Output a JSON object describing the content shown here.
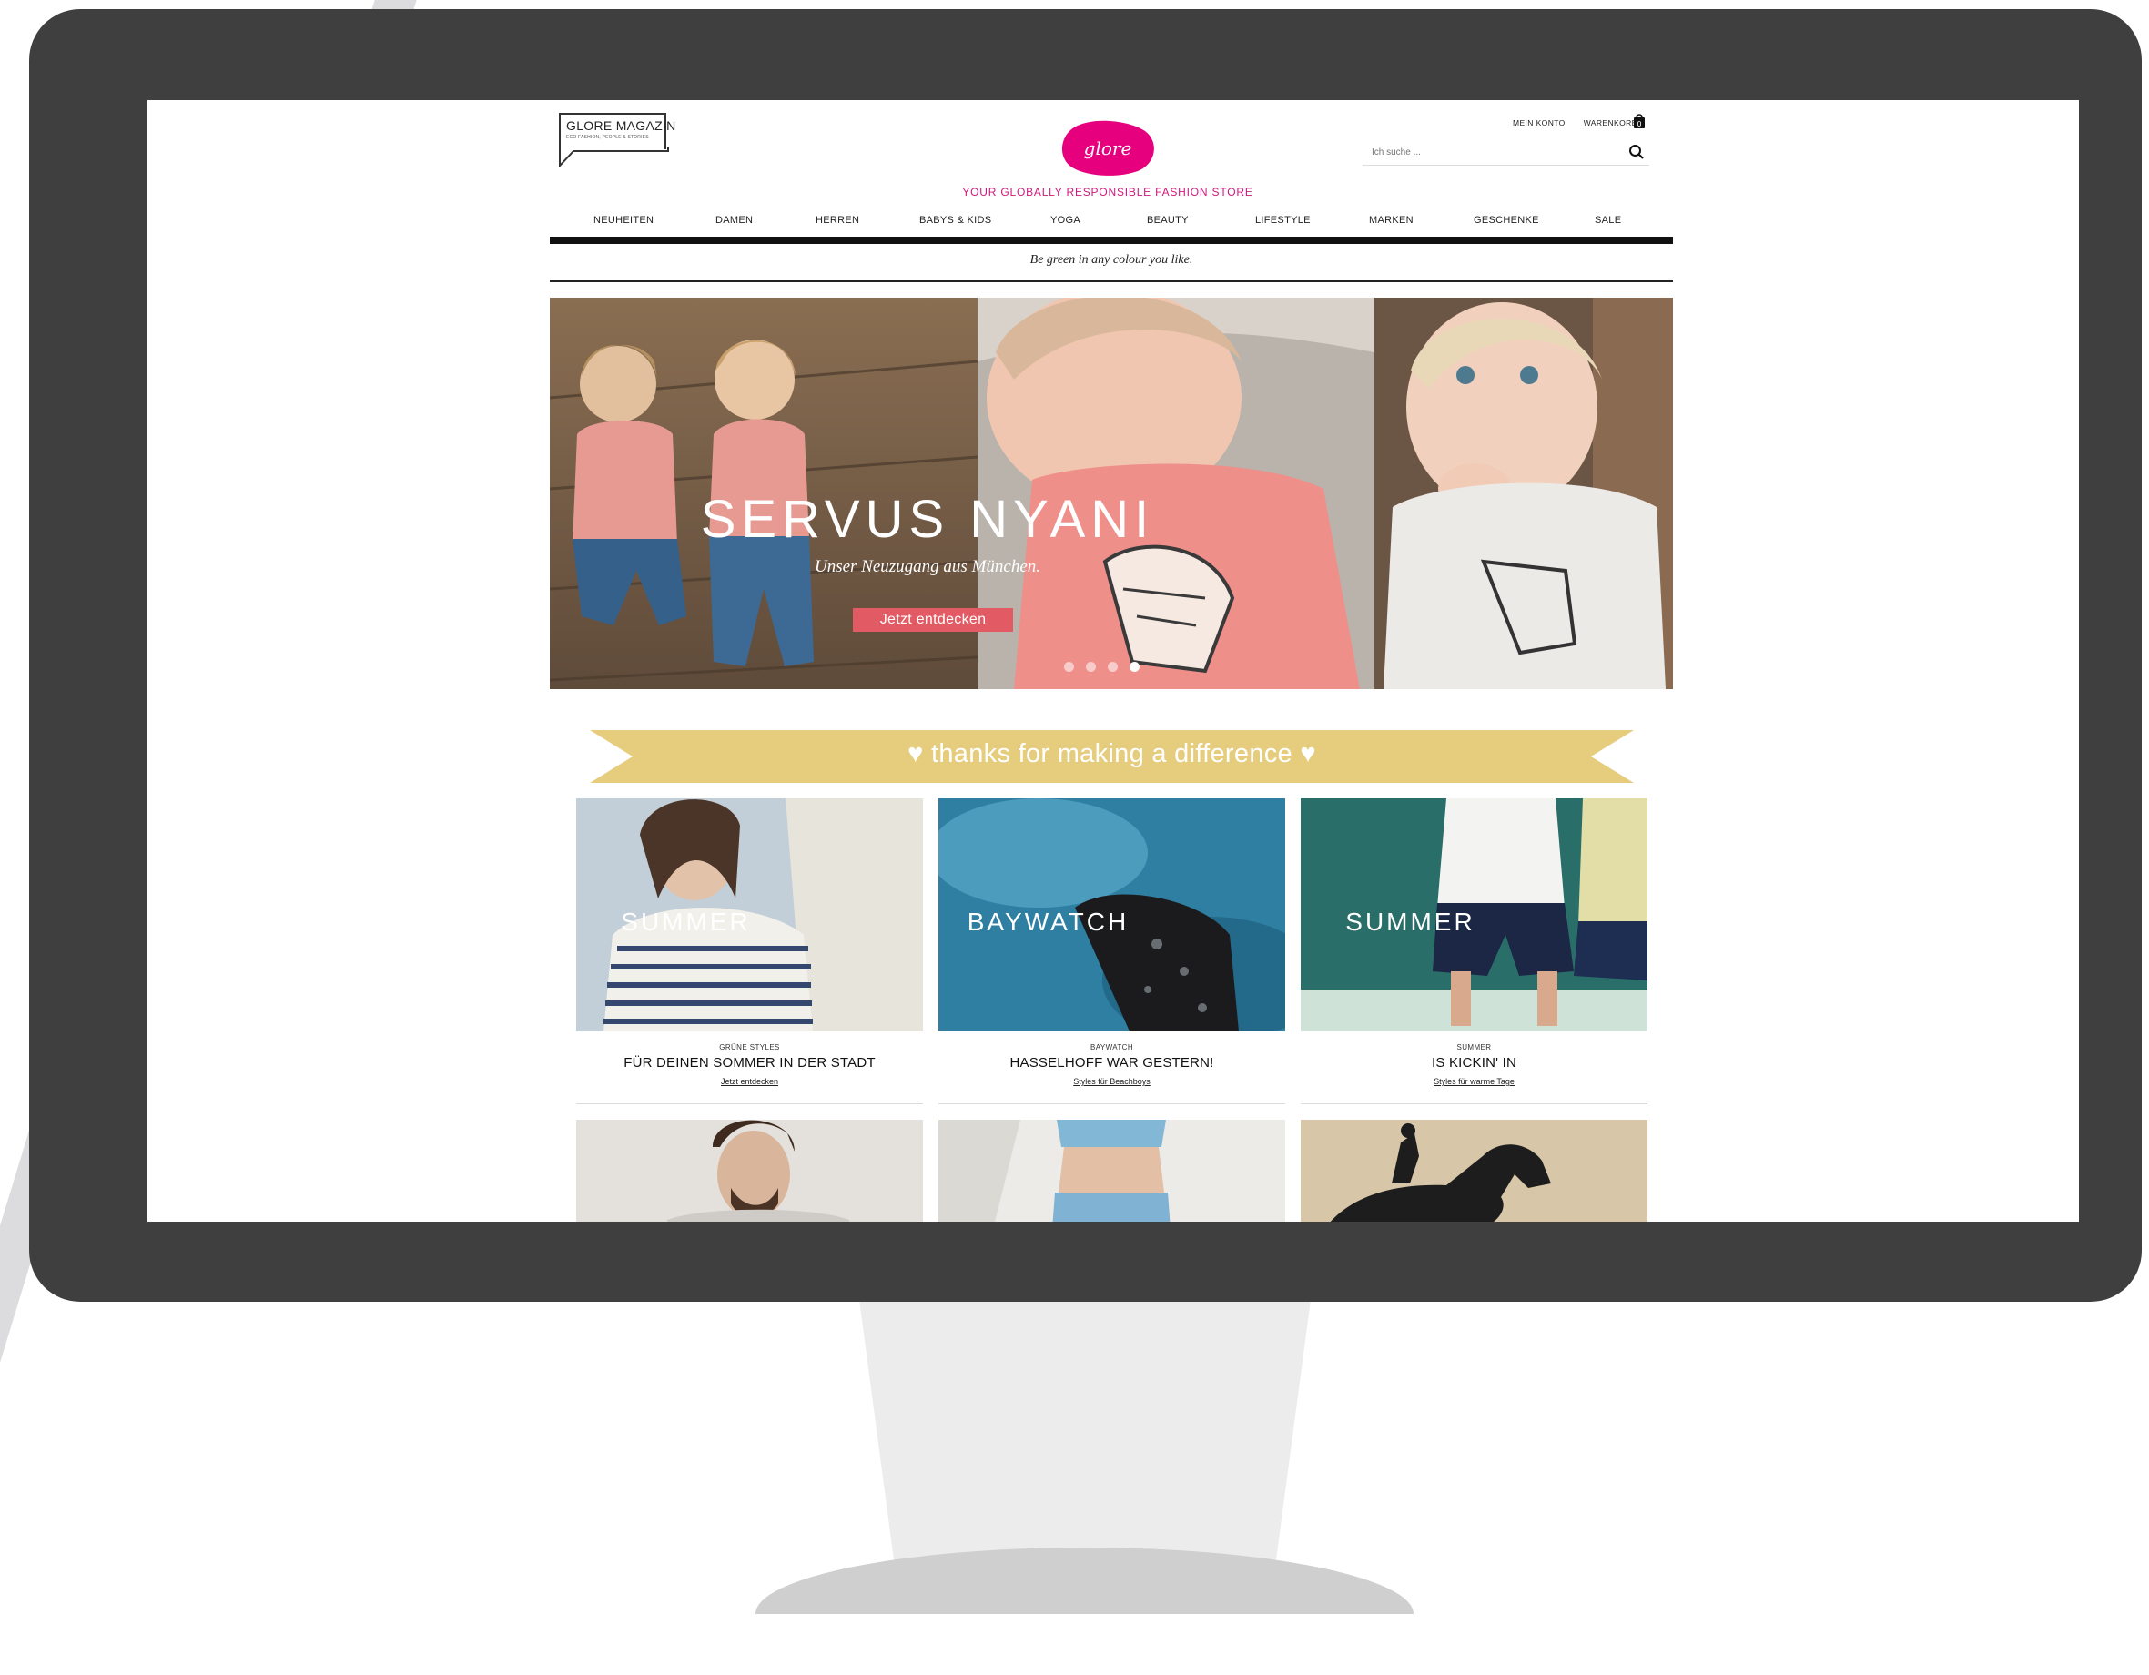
{
  "colors": {
    "accent": "#e6007e",
    "banner": "#e6cc7d",
    "cta": "#e25a63",
    "bezel": "#3f3f3f"
  },
  "header": {
    "magazin_title": "GLORE MAGAZIN",
    "magazin_sub": "ECO FASHION, PEOPLE & STORIES",
    "brand_logo": "glore",
    "tagline": "YOUR GLOBALLY RESPONSIBLE FASHION STORE",
    "account": "MEIN KONTO",
    "cart": "WARENKORB",
    "cart_count": "0",
    "search_placeholder": "Ich suche ..."
  },
  "nav": {
    "items": [
      "NEUHEITEN",
      "DAMEN",
      "HERREN",
      "BABYS & KIDS",
      "YOGA",
      "BEAUTY",
      "LIFESTYLE",
      "MARKEN",
      "GESCHENKE",
      "SALE"
    ]
  },
  "motto": "Be green in any colour you like.",
  "hero": {
    "title": "SERVUS NYANI",
    "subtitle": "Unser Neuzugang aus München.",
    "cta": "Jetzt entdecken",
    "slide_count": 4,
    "active_slide": 4
  },
  "banner": {
    "text": "♥ thanks for making a difference ♥"
  },
  "tiles": [
    {
      "overlay": "SUMMER",
      "kicker": "GRÜNE STYLES",
      "heading": "FÜR DEINEN SOMMER IN DER STADT",
      "link": "Jetzt entdecken"
    },
    {
      "overlay": "BAYWATCH",
      "kicker": "BAYWATCH",
      "heading": "HASSELHOFF WAR GESTERN!",
      "link": "Styles für Beachboys"
    },
    {
      "overlay": "SUMMER",
      "kicker": "SUMMER",
      "heading": "IS KICKIN' IN",
      "link": "Styles für warme Tage"
    }
  ]
}
